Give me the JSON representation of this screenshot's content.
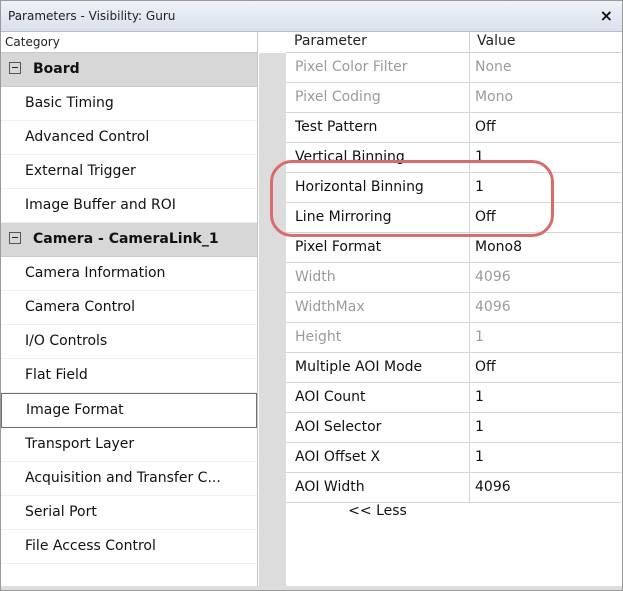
{
  "window": {
    "title": "Parameters - Visibility: Guru",
    "close": "×"
  },
  "left": {
    "header": "Category",
    "groups": [
      {
        "label": "Board",
        "items": [
          "Basic Timing",
          "Advanced Control",
          "External Trigger",
          "Image Buffer and ROI"
        ]
      },
      {
        "label": "Camera - CameraLink_1",
        "items": [
          "Camera Information",
          "Camera Control",
          "I/O Controls",
          "Flat Field",
          "Image Format",
          "Transport Layer",
          "Acquisition and Transfer C...",
          "Serial Port",
          "File Access Control"
        ]
      }
    ],
    "selected_item": "Image Format"
  },
  "right": {
    "headers": {
      "parameter": "Parameter",
      "value": "Value"
    },
    "rows": [
      {
        "name": "Pixel Color Filter",
        "value": "None",
        "muted": true
      },
      {
        "name": "Pixel Coding",
        "value": "Mono",
        "muted": true
      },
      {
        "name": "Test Pattern",
        "value": "Off",
        "muted": false
      },
      {
        "name": "Vertical Binning",
        "value": "1",
        "muted": false
      },
      {
        "name": "Horizontal Binning",
        "value": "1",
        "muted": false
      },
      {
        "name": "Line Mirroring",
        "value": "Off",
        "muted": false
      },
      {
        "name": "Pixel Format",
        "value": "Mono8",
        "muted": false
      },
      {
        "name": "Width",
        "value": "4096",
        "muted": true
      },
      {
        "name": "WidthMax",
        "value": "4096",
        "muted": true
      },
      {
        "name": "Height",
        "value": "1",
        "muted": true
      },
      {
        "name": "Multiple AOI Mode",
        "value": "Off",
        "muted": false
      },
      {
        "name": "AOI Count",
        "value": "1",
        "muted": false
      },
      {
        "name": "AOI Selector",
        "value": "1",
        "muted": false
      },
      {
        "name": "AOI Offset X",
        "value": "1",
        "muted": false
      },
      {
        "name": "AOI Width",
        "value": "4096",
        "muted": false
      }
    ],
    "less_label": "<< Less"
  },
  "colors": {
    "highlight": "#d86c6c",
    "muted_text": "#9b9b9b"
  }
}
